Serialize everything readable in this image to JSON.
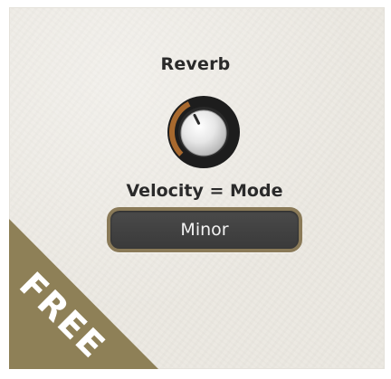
{
  "reverb": {
    "label": "Reverb",
    "value_fraction": 0.4
  },
  "velocity": {
    "label": "Velocity = Mode"
  },
  "mode": {
    "selected": "Minor"
  },
  "badge": {
    "text": "FREE"
  },
  "colors": {
    "background": "#ece9e2",
    "knob_ring": "#1d1d1d",
    "knob_arc": "#a8692e",
    "selector_border": "#8a7a58",
    "selector_fill": "#444444",
    "badge": "#8e8057",
    "text": "#2a2a2a"
  }
}
